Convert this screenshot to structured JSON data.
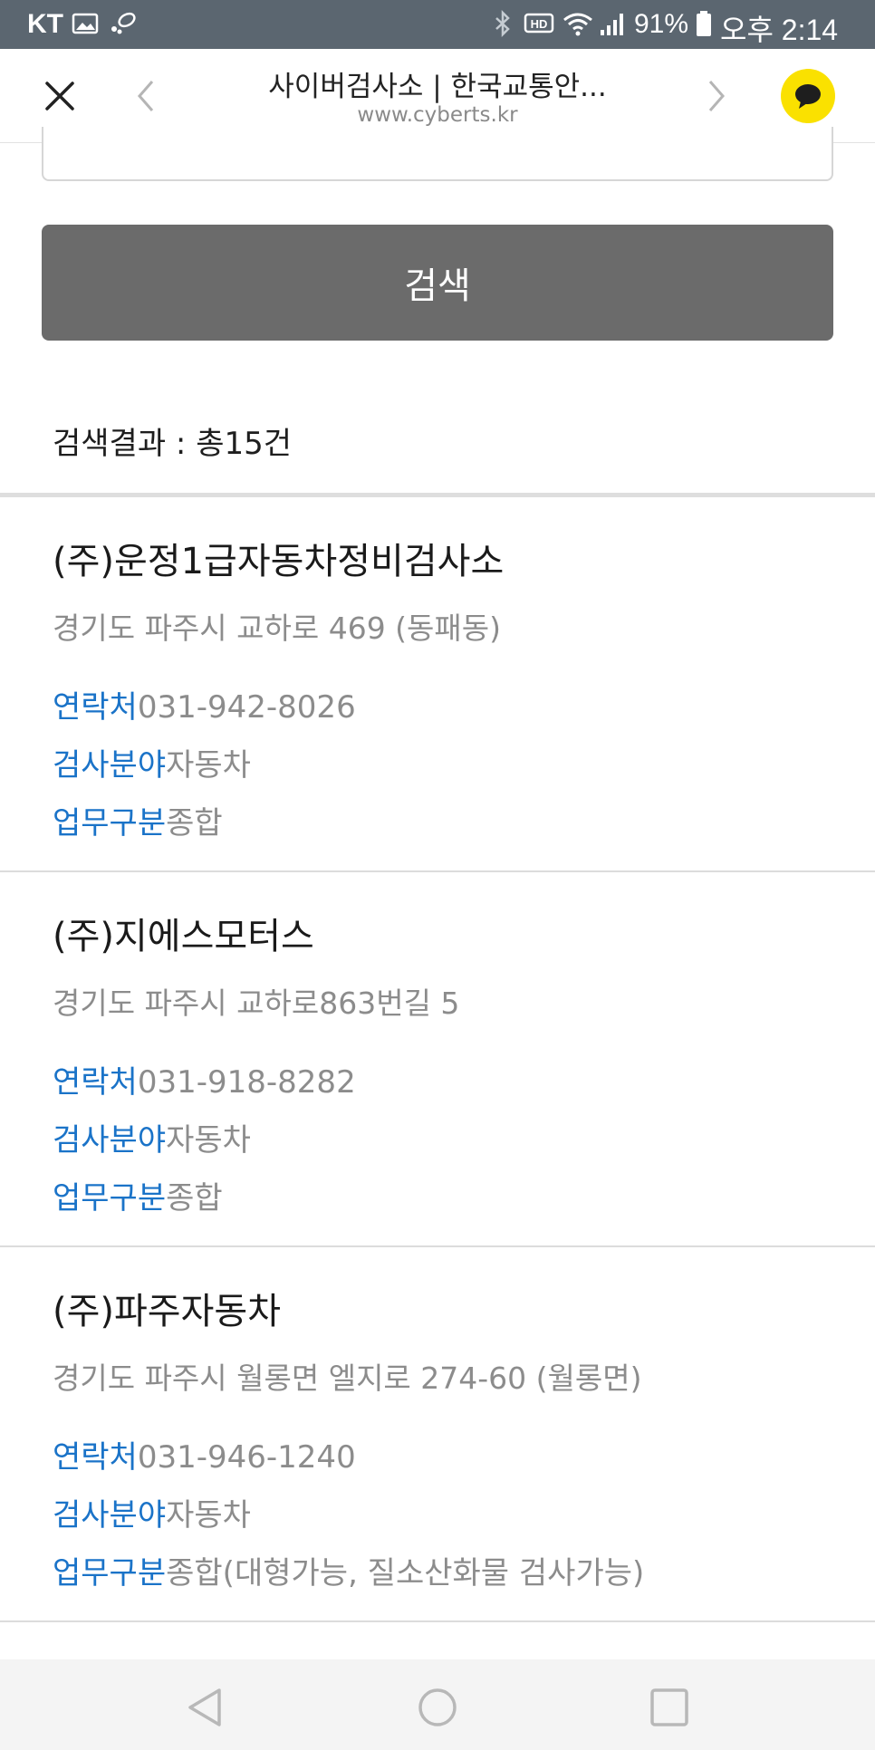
{
  "status_bar": {
    "carrier": "KT",
    "battery_percent": "91%",
    "time": "오후 2:14"
  },
  "browser": {
    "title": "사이버검사소 | 한국교통안...",
    "url": "www.cyberts.kr"
  },
  "search": {
    "button_label": "검색",
    "result_summary": "검색결과 : 총15건"
  },
  "labels": {
    "contact": "연락처",
    "field": "검사분야",
    "work_type": "업무구분"
  },
  "results": [
    {
      "name": "(주)운정1급자동차정비검사소",
      "address": "경기도 파주시 교하로 469 (동패동)",
      "contact": "031-942-8026",
      "field": "자동차",
      "work_type": "종합"
    },
    {
      "name": "(주)지에스모터스",
      "address": "경기도 파주시 교하로863번길 5",
      "contact": "031-918-8282",
      "field": "자동차",
      "work_type": "종합"
    },
    {
      "name": "(주)파주자동차",
      "address": "경기도 파주시 월롱면 엘지로 274-60 (월롱면)",
      "contact": "031-946-1240",
      "field": "자동차",
      "work_type": "종합(대형가능, 질소산화물 검사가능)"
    }
  ],
  "colors": {
    "status_bar": "#5b6670",
    "search_button": "#6b6b6b",
    "label_blue": "#1a73c8",
    "muted_text": "#8c8c8c",
    "kakao_yellow": "#fae100"
  }
}
